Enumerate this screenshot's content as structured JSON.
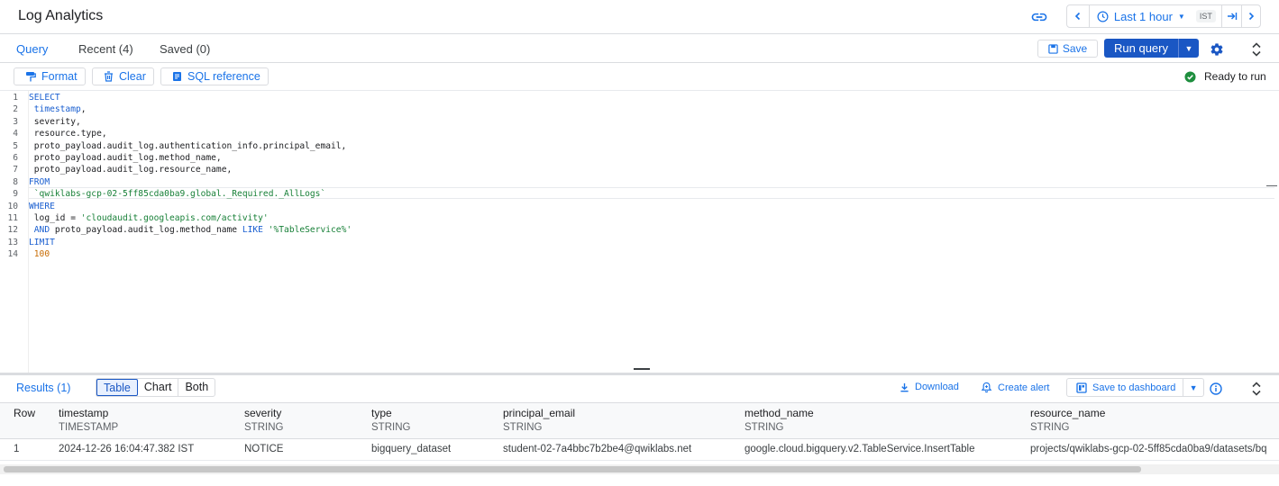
{
  "header": {
    "title": "Log Analytics",
    "time_range": "Last 1 hour",
    "timezone": "IST"
  },
  "query_tabs": [
    "Query",
    "Recent (4)",
    "Saved (0)"
  ],
  "actions": {
    "save": "Save",
    "run_query": "Run query"
  },
  "toolbar": {
    "format": "Format",
    "clear": "Clear",
    "sql_reference": "SQL reference",
    "status": "Ready to run"
  },
  "editor": {
    "lines": [
      [
        {
          "t": "SELECT",
          "c": "kw"
        }
      ],
      [
        {
          "t": " timestamp",
          "c": "kw"
        },
        {
          "t": ",",
          "c": ""
        }
      ],
      [
        {
          "t": " severity,",
          "c": ""
        }
      ],
      [
        {
          "t": " resource.type,",
          "c": ""
        }
      ],
      [
        {
          "t": " proto_payload.audit_log.authentication_info.principal_email,",
          "c": ""
        }
      ],
      [
        {
          "t": " proto_payload.audit_log.method_name,",
          "c": ""
        }
      ],
      [
        {
          "t": " proto_payload.audit_log.resource_name,",
          "c": ""
        }
      ],
      [
        {
          "t": "FROM",
          "c": "kw"
        }
      ],
      [
        {
          "t": " `qwiklabs-gcp-02-5ff85cda0ba9.global._Required._AllLogs`",
          "c": "str"
        }
      ],
      [
        {
          "t": "WHERE",
          "c": "kw"
        }
      ],
      [
        {
          "t": " log_id = ",
          "c": ""
        },
        {
          "t": "'cloudaudit.googleapis.com/activity'",
          "c": "str"
        }
      ],
      [
        {
          "t": " AND",
          "c": "kw"
        },
        {
          "t": " proto_payload.audit_log.method_name ",
          "c": ""
        },
        {
          "t": "LIKE",
          "c": "kw"
        },
        {
          "t": " ",
          "c": ""
        },
        {
          "t": "'%TableService%'",
          "c": "str"
        }
      ],
      [
        {
          "t": "LIMIT",
          "c": "kw"
        }
      ],
      [
        {
          "t": " 100",
          "c": "num"
        }
      ]
    ]
  },
  "results": {
    "tab_label": "Results (1)",
    "views": [
      "Table",
      "Chart",
      "Both"
    ],
    "active_view": "Table",
    "download": "Download",
    "create_alert": "Create alert",
    "save_to_dashboard": "Save to dashboard",
    "columns": [
      {
        "name": "Row",
        "type": ""
      },
      {
        "name": "timestamp",
        "type": "TIMESTAMP"
      },
      {
        "name": "severity",
        "type": "STRING"
      },
      {
        "name": "type",
        "type": "STRING"
      },
      {
        "name": "principal_email",
        "type": "STRING"
      },
      {
        "name": "method_name",
        "type": "STRING"
      },
      {
        "name": "resource_name",
        "type": "STRING"
      }
    ],
    "rows": [
      [
        "1",
        "2024-12-26 16:04:47.382 IST",
        "NOTICE",
        "bigquery_dataset",
        "student-02-7a4bbc7b2be4@qwiklabs.net",
        "google.cloud.bigquery.v2.TableService.InsertTable",
        "projects/qwiklabs-gcp-02-5ff85cda0ba9/datasets/bq"
      ]
    ]
  },
  "colors": {
    "accent": "#1a73e8",
    "run_button": "#1a57c4",
    "ok": "#1e8e3e"
  }
}
